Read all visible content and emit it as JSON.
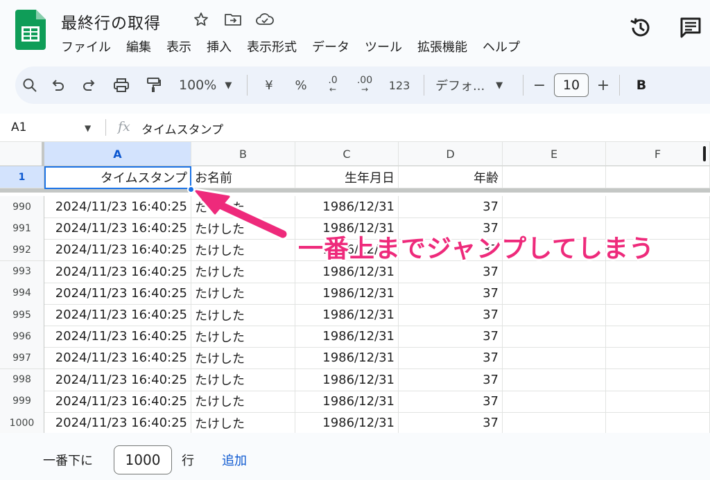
{
  "header": {
    "title": "最終行の取得",
    "menu": [
      "ファイル",
      "編集",
      "表示",
      "挿入",
      "表示形式",
      "データ",
      "ツール",
      "拡張機能",
      "ヘルプ"
    ]
  },
  "toolbar": {
    "zoom": "100%",
    "currency": "¥",
    "percent": "%",
    "dec_decrease": ".0",
    "dec_increase": ".00",
    "number_format": "123",
    "font": "デフォ...",
    "minus": "−",
    "font_size": "10",
    "plus": "+",
    "bold": "B"
  },
  "formula_bar": {
    "cell_ref": "A1",
    "fx": "fx",
    "value": "タイムスタンプ"
  },
  "columns": [
    "A",
    "B",
    "C",
    "D",
    "E",
    "F"
  ],
  "header_row": {
    "num": "1",
    "cells": [
      "タイムスタンプ",
      "お名前",
      "生年月日",
      "年齢",
      "",
      ""
    ]
  },
  "rows": [
    {
      "num": "990",
      "a": "2024/11/23 16:40:25",
      "b": "たけした",
      "c": "1986/12/31",
      "d": "37"
    },
    {
      "num": "991",
      "a": "2024/11/23 16:40:25",
      "b": "たけした",
      "c": "1986/12/31",
      "d": "37"
    },
    {
      "num": "992",
      "a": "2024/11/23 16:40:25",
      "b": "たけした",
      "c": "1986/12/31",
      "d": "37"
    },
    {
      "num": "993",
      "a": "2024/11/23 16:40:25",
      "b": "たけした",
      "c": "1986/12/31",
      "d": "37"
    },
    {
      "num": "994",
      "a": "2024/11/23 16:40:25",
      "b": "たけした",
      "c": "1986/12/31",
      "d": "37"
    },
    {
      "num": "995",
      "a": "2024/11/23 16:40:25",
      "b": "たけした",
      "c": "1986/12/31",
      "d": "37"
    },
    {
      "num": "996",
      "a": "2024/11/23 16:40:25",
      "b": "たけした",
      "c": "1986/12/31",
      "d": "37"
    },
    {
      "num": "997",
      "a": "2024/11/23 16:40:25",
      "b": "たけした",
      "c": "1986/12/31",
      "d": "37"
    },
    {
      "num": "998",
      "a": "2024/11/23 16:40:25",
      "b": "たけした",
      "c": "1986/12/31",
      "d": "37"
    },
    {
      "num": "999",
      "a": "2024/11/23 16:40:25",
      "b": "たけした",
      "c": "1986/12/31",
      "d": "37"
    },
    {
      "num": "1000",
      "a": "2024/11/23 16:40:25",
      "b": "たけした",
      "c": "1986/12/31",
      "d": "37"
    }
  ],
  "bottom": {
    "label": "一番下に",
    "count": "1000",
    "unit": "行",
    "add": "追加"
  },
  "annotation": {
    "text": "一番上までジャンプしてしまう",
    "color": "#ee2a7b"
  },
  "colors": {
    "accent": "#1a73e8",
    "sheets_green": "#0f9d58"
  }
}
